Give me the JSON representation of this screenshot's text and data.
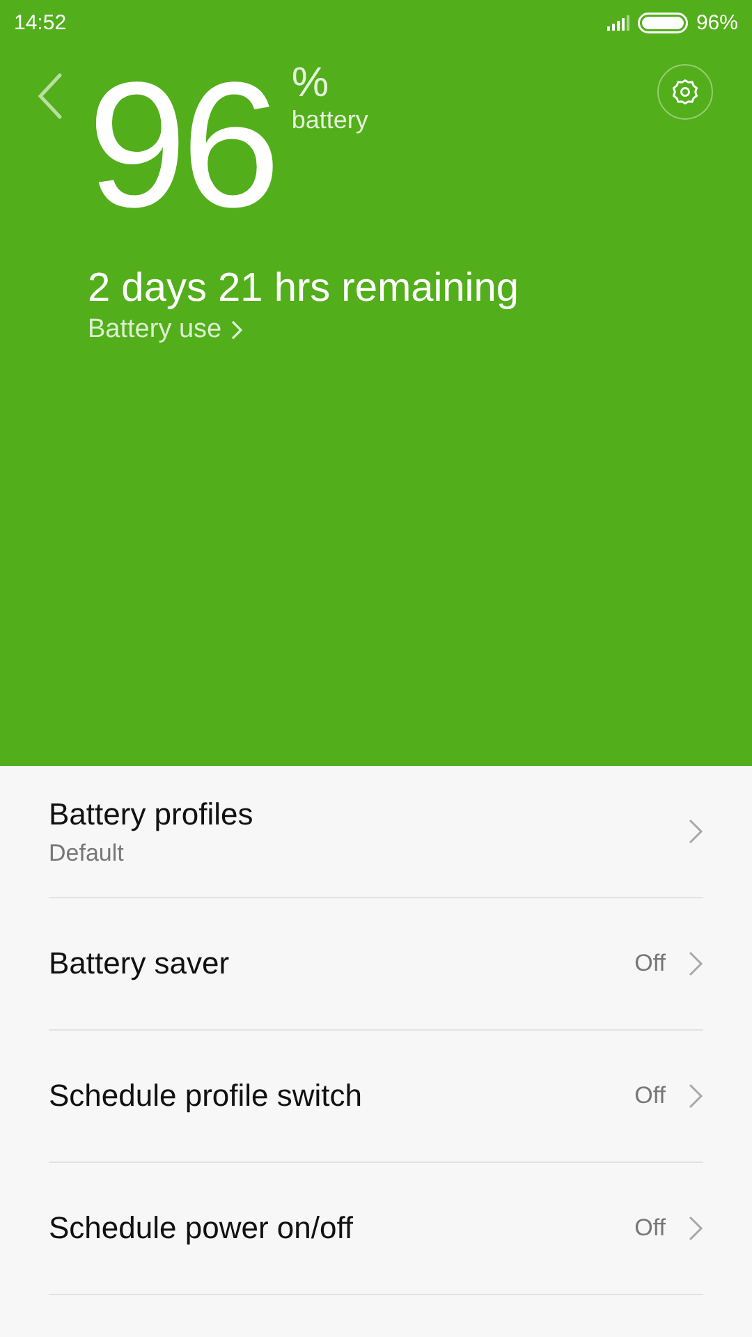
{
  "status_bar": {
    "time": "14:52",
    "battery_text": "96%"
  },
  "header": {
    "percent": "96",
    "unit": "%",
    "unit_label": "battery",
    "remaining": "2 days 21 hrs remaining",
    "link": "Battery use"
  },
  "items": [
    {
      "title": "Battery profiles",
      "subtitle": "Default"
    },
    {
      "title": "Battery saver",
      "value": "Off"
    },
    {
      "title": "Schedule profile switch",
      "value": "Off"
    },
    {
      "title": "Schedule power on/off",
      "value": "Off"
    }
  ]
}
